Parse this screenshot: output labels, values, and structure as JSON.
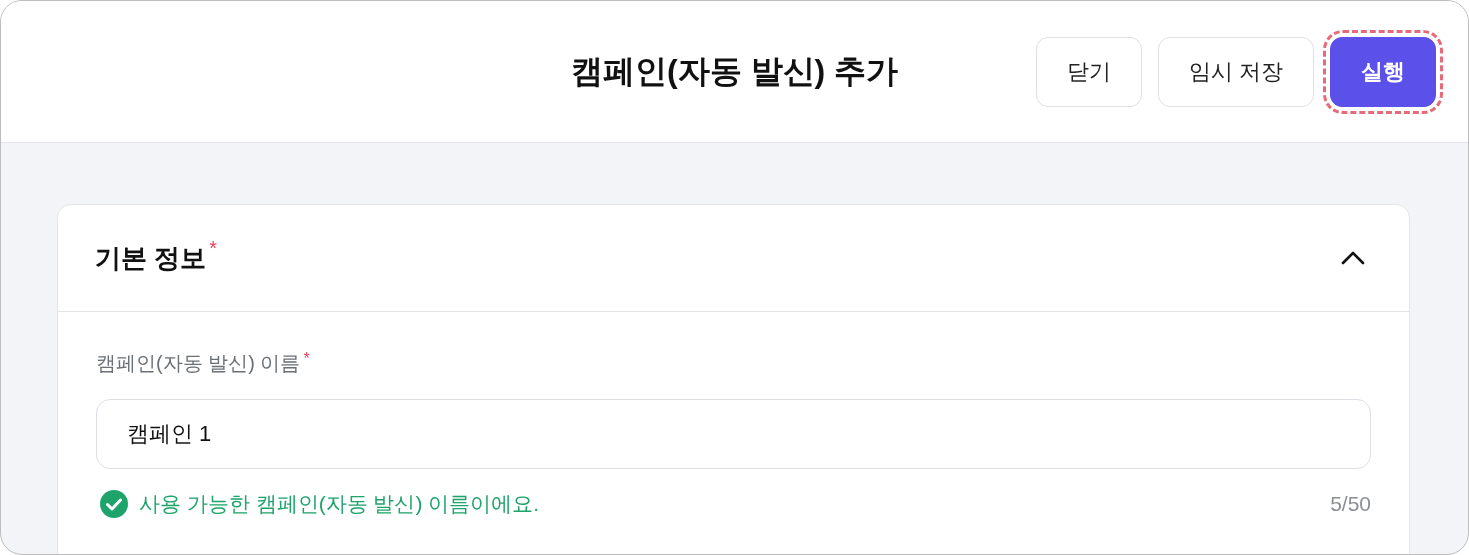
{
  "window": {
    "title": "캠페인(자동 발신) 추가"
  },
  "header_buttons": [
    {
      "label": "닫기",
      "kind": "secondary",
      "highlighted": false
    },
    {
      "label": "임시 저장",
      "kind": "secondary",
      "highlighted": false
    },
    {
      "label": "실행",
      "kind": "primary",
      "highlighted": true
    }
  ],
  "section": {
    "title": "기본 정보",
    "required_mark": "*",
    "expanded": true,
    "field": {
      "label": "캠페인(자동 발신) 이름",
      "required_mark": "*",
      "value": "캠페인 1",
      "validation": {
        "valid": true,
        "message": "사용 가능한 캠페인(자동 발신) 이름이에요."
      },
      "counter": "5/50"
    }
  }
}
